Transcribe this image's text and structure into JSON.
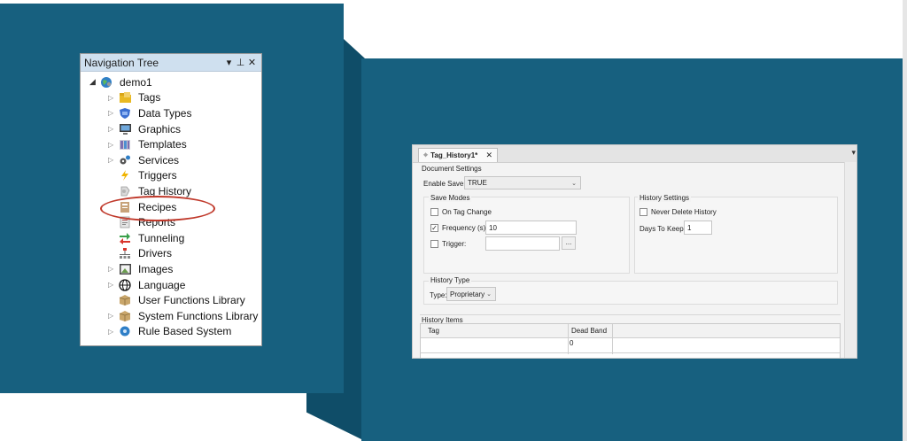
{
  "navigation_tree": {
    "title": "Navigation Tree",
    "header_buttons": [
      "▾",
      "⊥",
      "✕"
    ],
    "root": {
      "label": "demo1",
      "icon": "globe-icon"
    },
    "items": [
      {
        "label": "Tags",
        "icon": "tags-folder-icon"
      },
      {
        "label": "Data Types",
        "icon": "data-types-shield-icon"
      },
      {
        "label": "Graphics",
        "icon": "monitor-icon"
      },
      {
        "label": "Templates",
        "icon": "templates-icon"
      },
      {
        "label": "Services",
        "icon": "services-gears-icon"
      },
      {
        "label": "Triggers",
        "icon": "lightning-icon"
      },
      {
        "label": "Tag History",
        "icon": "history-tag-icon"
      },
      {
        "label": "Recipes",
        "icon": "recipes-icon"
      },
      {
        "label": "Reports",
        "icon": "reports-icon"
      },
      {
        "label": "Tunneling",
        "icon": "tunneling-arrows-icon"
      },
      {
        "label": "Drivers",
        "icon": "drivers-network-icon"
      },
      {
        "label": "Images",
        "icon": "images-icon"
      },
      {
        "label": "Language",
        "icon": "language-globe-icon"
      },
      {
        "label": "User Functions Library",
        "icon": "library-box-icon"
      },
      {
        "label": "System Functions Library",
        "icon": "library-box-icon"
      },
      {
        "label": "Rule Based System",
        "icon": "rule-gear-icon"
      }
    ]
  },
  "document": {
    "tab_title": "Tag_History1*",
    "document_settings_label": "Document Settings",
    "enable_save_label": "Enable Save:",
    "enable_save_value": "TRUE",
    "save_modes": {
      "title": "Save Modes",
      "on_tag_change_label": "On Tag Change",
      "on_tag_change_checked": false,
      "frequency_label": "Frequency (s):",
      "frequency_checked": true,
      "frequency_value": "10",
      "trigger_label": "Trigger:",
      "trigger_checked": false,
      "trigger_value": "",
      "trigger_button": "..."
    },
    "history_settings": {
      "title": "History Settings",
      "never_delete_label": "Never Delete History",
      "never_delete_checked": false,
      "days_to_keep_label": "Days To Keep:",
      "days_to_keep_value": "1"
    },
    "history_type": {
      "title": "History Type",
      "type_label": "Type:",
      "type_value": "Proprietary"
    },
    "history_items": {
      "title": "History Items",
      "columns": [
        "Tag",
        "Dead Band"
      ],
      "rows": [
        [
          "",
          "0"
        ]
      ]
    }
  },
  "colors": {
    "panel_blue": "#17607f",
    "selection_ring": "#c0392b"
  }
}
